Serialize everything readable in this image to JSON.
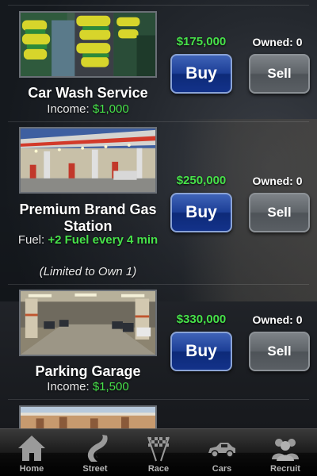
{
  "items": [
    {
      "name": "Car Wash Service",
      "income_label": "Income:",
      "income_value": "$1,000",
      "price": "$175,000",
      "owned": "Owned: 0",
      "buy_label": "Buy",
      "sell_label": "Sell"
    },
    {
      "name": "Premium Brand Gas Station",
      "fuel_label": "Fuel:",
      "fuel_value": "+2 Fuel every 4 min",
      "limit_note": "(Limited to Own 1)",
      "price": "$250,000",
      "owned": "Owned: 0",
      "buy_label": "Buy",
      "sell_label": "Sell"
    },
    {
      "name": "Parking Garage",
      "income_label": "Income:",
      "income_value": "$1,500",
      "price": "$330,000",
      "owned": "Owned: 0",
      "buy_label": "Buy",
      "sell_label": "Sell"
    }
  ],
  "tabs": [
    {
      "label": "Home",
      "icon": "home-icon"
    },
    {
      "label": "Street",
      "icon": "street-icon"
    },
    {
      "label": "Race",
      "icon": "checkered-flags-icon"
    },
    {
      "label": "Cars",
      "icon": "car-icon"
    },
    {
      "label": "Recruit",
      "icon": "people-icon"
    }
  ],
  "colors": {
    "price_green": "#47e24a",
    "buy_blue": "#1d3f97",
    "sell_gray": "#5f6469"
  }
}
